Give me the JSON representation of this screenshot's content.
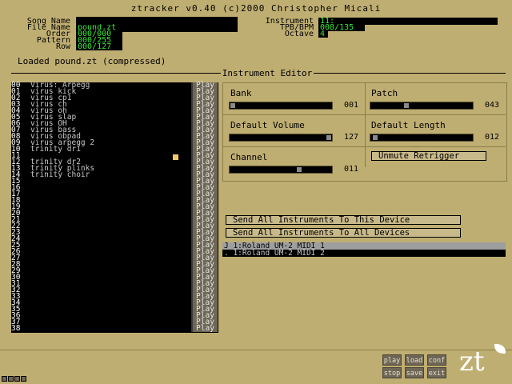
{
  "header": {
    "title": "ztracker v0.40 (c)2000 Christopher Micali"
  },
  "song": {
    "song_name_label": "Song Name",
    "song_name": "",
    "file_name_label": "File Name",
    "file_name": "pound.zt",
    "order_label": "Order",
    "order": "000/000",
    "pattern_label": "Pattern",
    "pattern": "000/255",
    "row_label": "Row",
    "row": "000/127"
  },
  "instrument_info": {
    "instrument_label": "Instrument",
    "instrument": "11:",
    "tpb_label": "TPB/BPM",
    "tpb": "008/135",
    "octave_label": "Octave",
    "octave": "4"
  },
  "status": "Loaded pound.zt (compressed)",
  "section_title": "Instrument Editor",
  "play_label": "Play",
  "instruments": [
    {
      "num": "00",
      "name": "Virus: Arpegg"
    },
    {
      "num": "01",
      "name": "virus kick"
    },
    {
      "num": "02",
      "name": "virus cp1"
    },
    {
      "num": "03",
      "name": "virus ch"
    },
    {
      "num": "04",
      "name": "virus oh"
    },
    {
      "num": "05",
      "name": "virus slap"
    },
    {
      "num": "06",
      "name": "virus OH"
    },
    {
      "num": "07",
      "name": "virus bass"
    },
    {
      "num": "08",
      "name": "virus obpad"
    },
    {
      "num": "09",
      "name": "virus arpegg 2"
    },
    {
      "num": "10",
      "name": "trinity dr1"
    },
    {
      "num": "11",
      "name": ""
    },
    {
      "num": "12",
      "name": "trinity dr2"
    },
    {
      "num": "13",
      "name": "trinity plinks"
    },
    {
      "num": "14",
      "name": "trinity choir"
    },
    {
      "num": "15",
      "name": ""
    },
    {
      "num": "16",
      "name": ""
    },
    {
      "num": "17",
      "name": ""
    },
    {
      "num": "18",
      "name": ""
    },
    {
      "num": "19",
      "name": ""
    },
    {
      "num": "20",
      "name": ""
    },
    {
      "num": "21",
      "name": ""
    },
    {
      "num": "22",
      "name": ""
    },
    {
      "num": "23",
      "name": ""
    },
    {
      "num": "24",
      "name": ""
    },
    {
      "num": "25",
      "name": ""
    },
    {
      "num": "26",
      "name": ""
    },
    {
      "num": "27",
      "name": ""
    },
    {
      "num": "28",
      "name": ""
    },
    {
      "num": "29",
      "name": ""
    },
    {
      "num": "30",
      "name": ""
    },
    {
      "num": "31",
      "name": ""
    },
    {
      "num": "32",
      "name": ""
    },
    {
      "num": "33",
      "name": ""
    },
    {
      "num": "34",
      "name": ""
    },
    {
      "num": "35",
      "name": ""
    },
    {
      "num": "36",
      "name": ""
    },
    {
      "num": "37",
      "name": ""
    },
    {
      "num": "38",
      "name": ""
    }
  ],
  "editor": {
    "bank_label": "Bank",
    "bank_value": "001",
    "bank_level": 0.0,
    "patch_label": "Patch",
    "patch_value": "043",
    "patch_level": 0.34,
    "volume_label": "Default Volume",
    "volume_value": "127",
    "volume_level": 1.0,
    "length_label": "Default Length",
    "length_value": "012",
    "length_level": 0.02,
    "channel_label": "Channel",
    "channel_value": "011",
    "channel_level": 0.69,
    "unmute_label": "Unmute Retrigger"
  },
  "send_this_label": "Send All Instruments To This Device",
  "send_all_label": "Send All Instruments To All Devices",
  "devices": [
    {
      "label": "J 1:Roland UM-2 MIDI 1"
    },
    {
      "label": ". 1:Roland UM-2 MIDI 2"
    }
  ],
  "toolbar": {
    "play": "play",
    "load": "load",
    "conf": "conf",
    "stop": "stop",
    "save": "save",
    "exit": "exit"
  },
  "logo": "zt"
}
